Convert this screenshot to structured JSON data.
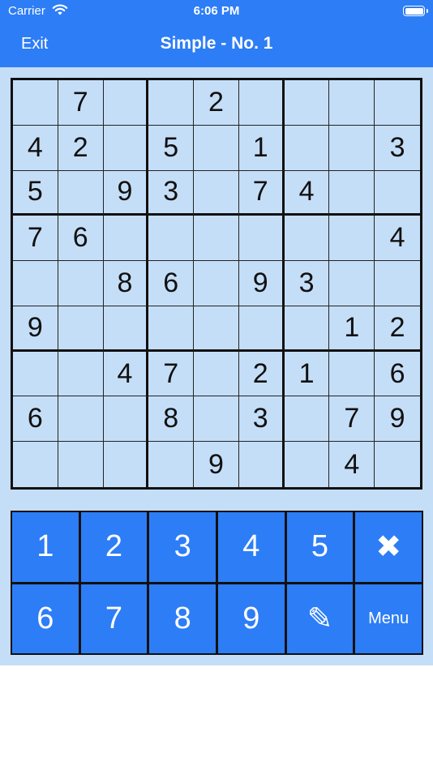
{
  "status": {
    "carrier": "Carrier",
    "time": "6:06 PM"
  },
  "nav": {
    "exit_label": "Exit",
    "title": "Simple - No. 1"
  },
  "board": {
    "grid": [
      [
        "",
        "7",
        "",
        "",
        "2",
        "",
        "",
        "",
        ""
      ],
      [
        "4",
        "2",
        "",
        "5",
        "",
        "1",
        "",
        "",
        "3"
      ],
      [
        "5",
        "",
        "9",
        "3",
        "",
        "7",
        "4",
        "",
        ""
      ],
      [
        "7",
        "6",
        "",
        "",
        "",
        "",
        "",
        "",
        "4"
      ],
      [
        "",
        "",
        "8",
        "6",
        "",
        "9",
        "3",
        "",
        ""
      ],
      [
        "9",
        "",
        "",
        "",
        "",
        "",
        "",
        "1",
        "2"
      ],
      [
        "",
        "",
        "4",
        "7",
        "",
        "2",
        "1",
        "",
        "6"
      ],
      [
        "6",
        "",
        "",
        "8",
        "",
        "3",
        "",
        "7",
        "9"
      ],
      [
        "",
        "",
        "",
        "",
        "9",
        "",
        "",
        "4",
        ""
      ]
    ]
  },
  "keypad": {
    "keys": [
      "1",
      "2",
      "3",
      "4",
      "5",
      "✖",
      "6",
      "7",
      "8",
      "9",
      "✎",
      "Menu"
    ],
    "key_names": [
      "key-1",
      "key-2",
      "key-3",
      "key-4",
      "key-5",
      "clear-icon",
      "key-6",
      "key-7",
      "key-8",
      "key-9",
      "pencil-icon",
      "menu-button"
    ]
  },
  "colors": {
    "accent": "#2d7df6",
    "board_bg": "#c5def8",
    "grid_line": "#111111"
  }
}
